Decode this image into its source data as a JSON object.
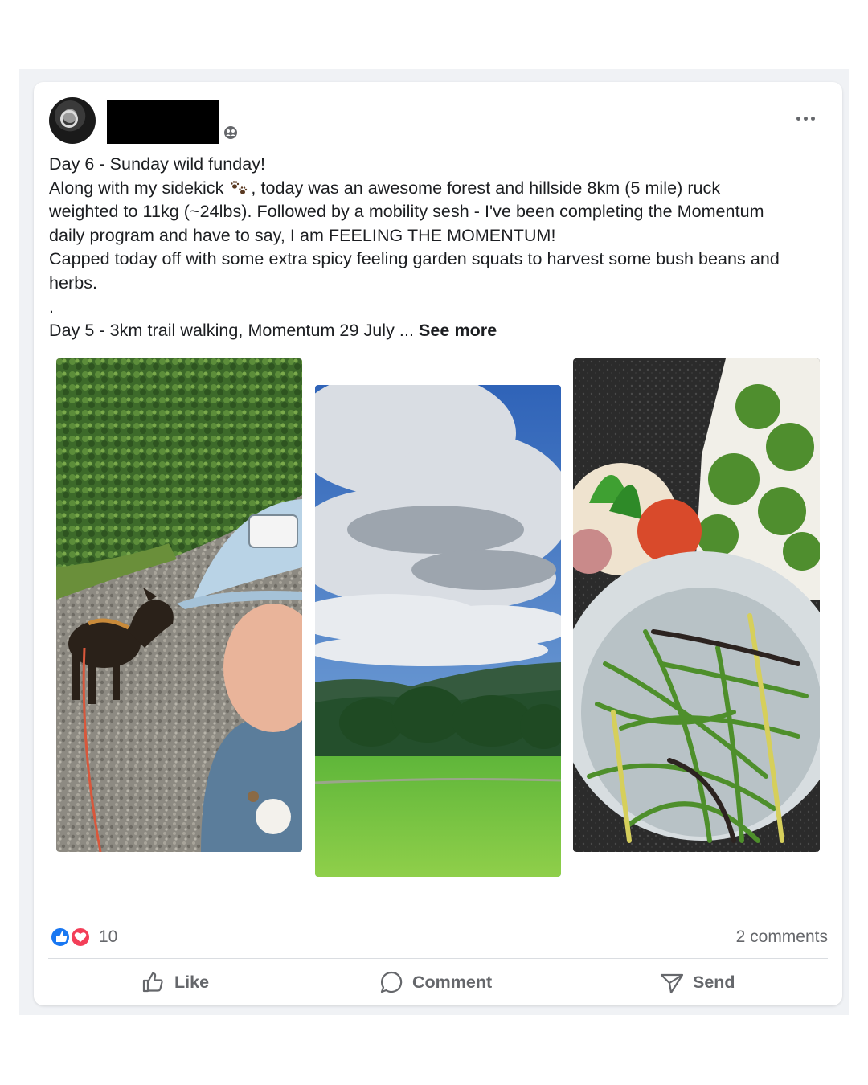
{
  "post": {
    "text_lines": [
      "Day 6 - Sunday wild funday!",
      "Along with my sidekick",
      ", today was an awesome forest and hillside 8km (5 mile) ruck",
      "weighted to 11kg (~24lbs). Followed by a mobility sesh - I've been completing the Momentum",
      "daily program and have to say, I am FEELING THE MOMENTUM!",
      "Capped today off with some extra spicy feeling garden squats to harvest some bush beans and",
      "herbs.",
      ".",
      "Day 5 - 3km trail walking, Momentum 29 July ..."
    ],
    "see_more": "See more",
    "sidekick_emoji": "paw-prints-icon"
  },
  "photos": [
    {
      "name": "selfie-with-dog"
    },
    {
      "name": "clouds-and-meadow"
    },
    {
      "name": "harvested-beans-and-herbs"
    }
  ],
  "reactions": {
    "icons": [
      "like-icon",
      "love-icon"
    ],
    "count": "10",
    "comments": "2 comments"
  },
  "actions": {
    "like": "Like",
    "comment": "Comment",
    "send": "Send"
  },
  "colors": {
    "like_blue": "#1877f2",
    "love_red": "#f33e58",
    "secondary_text": "#65676b"
  }
}
